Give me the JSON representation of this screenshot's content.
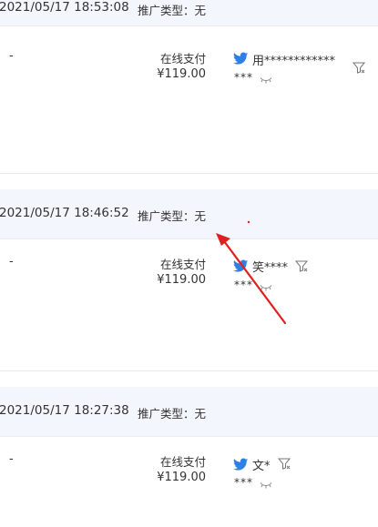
{
  "orders": [
    {
      "time": "2021/05/17 18:53:08",
      "promo_label": "推广类型",
      "promo_value": "无",
      "remark": "-",
      "pay_method": "在线支付",
      "pay_amount": "¥119.00",
      "buyer_name": "用************",
      "buyer_masked": "***"
    },
    {
      "time": "2021/05/17 18:46:52",
      "promo_label": "推广类型",
      "promo_value": "无",
      "remark": "-",
      "pay_method": "在线支付",
      "pay_amount": "¥119.00",
      "buyer_name": "笑****",
      "buyer_masked": "***"
    },
    {
      "time": "2021/05/17 18:27:38",
      "promo_label": "推广类型",
      "promo_value": "无",
      "remark": "-",
      "pay_method": "在线支付",
      "pay_amount": "¥119.00",
      "buyer_name": "文*",
      "buyer_masked": "***"
    }
  ],
  "separator": "：",
  "icons": {
    "buyer_platform": "bird-icon",
    "buyer_filter": "filter-icon",
    "reveal": "eye-closed-icon"
  },
  "colors": {
    "header_bg": "#f3f6fc",
    "bird_blue": "#2f7fe5",
    "annotation_red": "#e02020"
  }
}
